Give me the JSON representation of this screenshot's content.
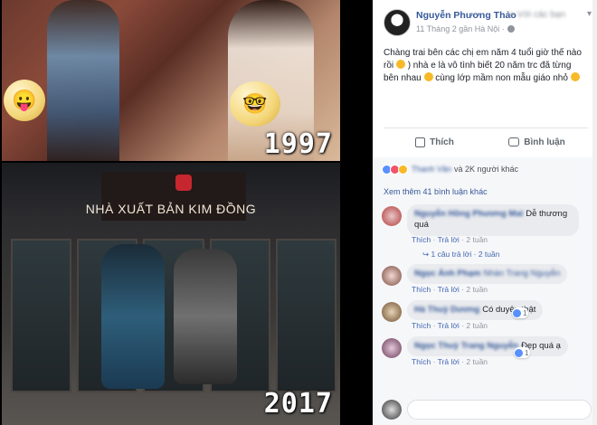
{
  "photo": {
    "year_top": "1997",
    "year_bottom": "2017",
    "store_sign": "NHÀ XUẤT BẢN KIM ĐỒNG"
  },
  "post": {
    "author": "Nguyễn Phương Thảo",
    "time": "11 Tháng 2 gần Hà Nội ·",
    "text_1": "Chàng trai bên các chị em năm 4 tuổi giờ thế nào rồi",
    "text_2": ") nhà e là vô tình biết 20 năm trc đã từng bên nhau",
    "text_3": " cùng lớp mầm non mẫu giáo nhỏ ",
    "actions": {
      "like": "Thích",
      "comment": "Bình luận"
    }
  },
  "reactions": {
    "summary": "và 2K người khác"
  },
  "comments_more": "Xem thêm 41 bình luận khác",
  "comments": [
    {
      "text": "Dễ thương quá",
      "like": "Thích",
      "reply": "Trả lời",
      "time": "2 tuần",
      "replies": "1 câu trả lời · 2 tuần"
    },
    {
      "text": "",
      "like": "Thích",
      "reply": "Trả lời",
      "time": "2 tuần"
    },
    {
      "text": "Có duyên thật",
      "like": "Thích",
      "reply": "Trả lời",
      "time": "2 tuần",
      "badge": "1"
    },
    {
      "text": "Đẹp quá ạ",
      "like": "Thích",
      "reply": "Trả lời",
      "time": "2 tuần",
      "badge": "1"
    }
  ],
  "colors": {
    "link": "#365899",
    "meta": "#90949c",
    "bubble": "#e9ebee"
  }
}
